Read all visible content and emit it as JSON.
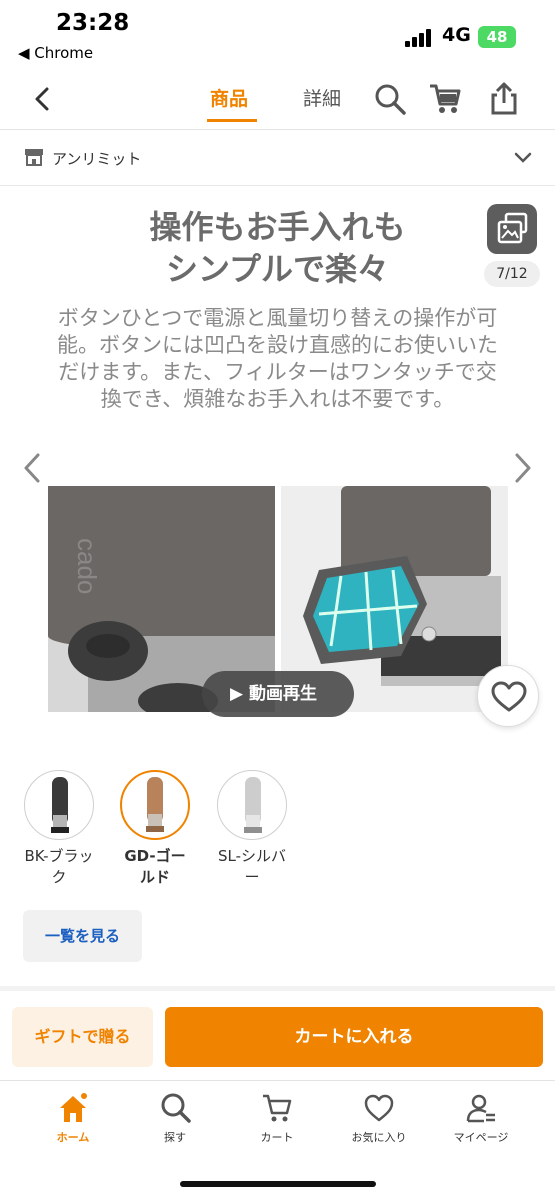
{
  "status_bar": {
    "time": "23:28",
    "back_app": "◀ Chrome",
    "network": "4G",
    "battery": "48"
  },
  "nav": {
    "tab_product": "商品",
    "tab_detail": "詳細"
  },
  "shop": {
    "name": "アンリミット"
  },
  "product_image": {
    "headline_line1": "操作もお手入れも",
    "headline_line2": "シンプルで楽々",
    "description": "ボタンひとつで電源と風量切り替えの操作が可能。ボタンには凹凸を設け直感的にお使いいただけます。また、フィルターはワンタッチで交換でき、煩雑なお手入れは不要です。",
    "counter": "7/12",
    "video_button": "▶ 動画再生",
    "photo_brand_text": "cado"
  },
  "variants": [
    {
      "label": "BK-ブラック",
      "color": "#3a3a3a",
      "selected": false
    },
    {
      "label": "GD-ゴールド",
      "color": "#b8835a",
      "selected": true
    },
    {
      "label": "SL-シルバー",
      "color": "#c9c9c9",
      "selected": false
    }
  ],
  "list_button": "一覧を見る",
  "actions": {
    "gift": "ギフトで贈る",
    "cart": "カートに入れる"
  },
  "tabbar": {
    "home": "ホーム",
    "search": "探す",
    "cart": "カート",
    "favorites": "お気に入り",
    "mypage": "マイページ"
  },
  "colors": {
    "accent": "#f08300",
    "link": "#1b5fc0"
  }
}
